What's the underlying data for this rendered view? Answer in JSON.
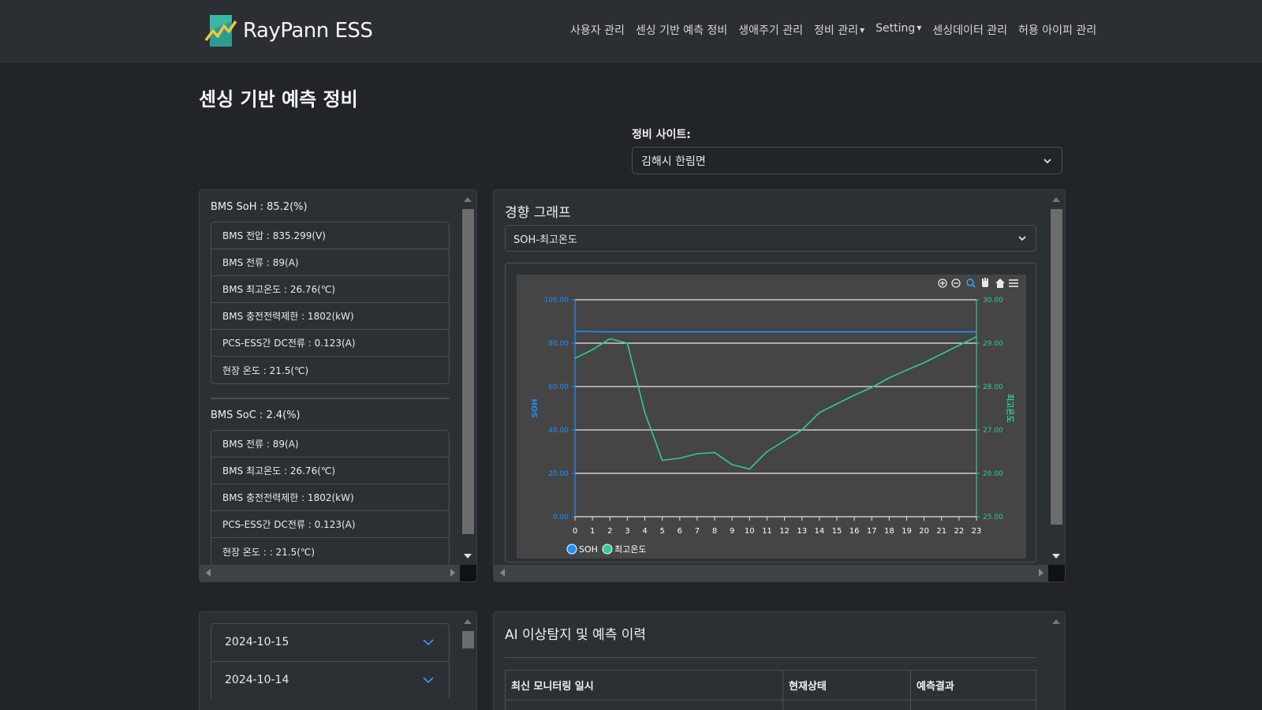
{
  "brand": {
    "name": "RayPann ESS"
  },
  "nav": [
    {
      "label": "사용자 관리",
      "caret": false
    },
    {
      "label": "센싱 기반 예측 정비",
      "caret": false
    },
    {
      "label": "생애주기 관리",
      "caret": false
    },
    {
      "label": "정비 관리",
      "caret": true
    },
    {
      "label": "Setting",
      "caret": true
    },
    {
      "label": "센싱데이터 관리",
      "caret": false
    },
    {
      "label": "허용 아이피 관리",
      "caret": false
    }
  ],
  "page": {
    "title": "센싱 기반 예측 정비"
  },
  "site": {
    "label": "정비 사이트:",
    "selected": "김해시 한림면"
  },
  "bms": {
    "soh_title": "BMS SoH : 85.2(%)",
    "soh_items": [
      "BMS 전압 : 835.299(V)",
      "BMS 전류 : 89(A)",
      "BMS 최고온도 : 26.76(℃)",
      "BMS 충전전력제한 : 1802(kW)",
      "PCS-ESS간 DC전류 : 0.123(A)",
      "현장 온도 : 21.5(℃)"
    ],
    "soc_title": "BMS SoC : 2.4(%)",
    "soc_items": [
      "BMS 전류 : 89(A)",
      "BMS 최고온도 : 26.76(℃)",
      "BMS 충전전력제한 : 1802(kW)",
      "PCS-ESS간 DC전류 : 0.123(A)",
      "현장 온도 : : 21.5(℃)"
    ]
  },
  "trend": {
    "title": "경향 그래프",
    "selected": "SOH-최고온도"
  },
  "chart_data": {
    "type": "line",
    "x": [
      0,
      1,
      2,
      3,
      4,
      5,
      6,
      7,
      8,
      9,
      10,
      11,
      12,
      13,
      14,
      15,
      16,
      17,
      18,
      19,
      20,
      21,
      22,
      23
    ],
    "series": [
      {
        "name": "SOH",
        "axis": "left",
        "color": "#1e90ff",
        "values": [
          85.5,
          85.3,
          85.2,
          85.2,
          85.2,
          85.2,
          85.2,
          85.2,
          85.2,
          85.2,
          85.2,
          85.2,
          85.2,
          85.2,
          85.2,
          85.2,
          85.2,
          85.2,
          85.2,
          85.2,
          85.2,
          85.2,
          85.2,
          85.2
        ]
      },
      {
        "name": "최고온도",
        "axis": "right",
        "color": "#2ecc8f",
        "values": [
          28.65,
          28.85,
          29.1,
          29.0,
          27.4,
          26.3,
          26.35,
          26.45,
          26.48,
          26.2,
          26.1,
          26.5,
          26.75,
          27.0,
          27.4,
          27.6,
          27.8,
          27.98,
          28.2,
          28.38,
          28.55,
          28.75,
          28.95,
          29.15
        ]
      }
    ],
    "ylabel": "SOH",
    "y2label": "최고온도",
    "ylim": [
      0,
      100
    ],
    "y2lim": [
      25,
      30
    ],
    "yticks": [
      "0.00",
      "20.00",
      "40.00",
      "60.00",
      "80.00",
      "100.00"
    ],
    "y2ticks": [
      "25.00",
      "26.00",
      "27.00",
      "28.00",
      "29.00",
      "30.00"
    ],
    "legend": [
      "SOH",
      "최고온도"
    ],
    "legend_position": "bottom-left",
    "grid": true
  },
  "accordion": [
    {
      "date": "2024-10-15"
    },
    {
      "date": "2024-10-14"
    }
  ],
  "ai": {
    "title": "AI 이상탐지 및 예측 이력",
    "headers": [
      "최신 모니터링 일시",
      "현재상태",
      "예측결과"
    ]
  }
}
